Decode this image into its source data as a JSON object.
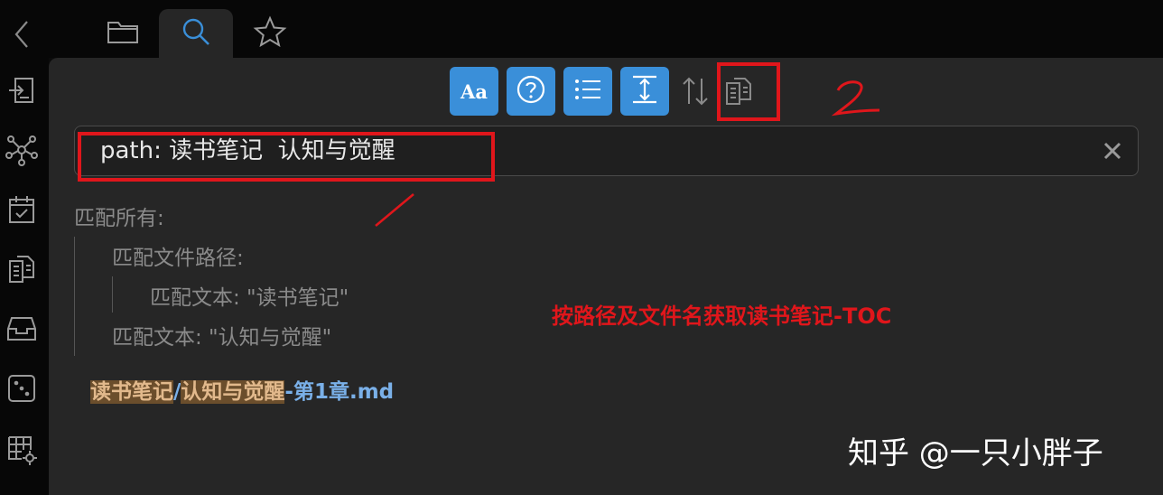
{
  "tabs": [
    {
      "name": "files",
      "icon": "folder-icon"
    },
    {
      "name": "search",
      "icon": "search-icon",
      "active": true
    },
    {
      "name": "bookmarks",
      "icon": "star-icon"
    }
  ],
  "ribbon_icons": [
    "file-import-icon",
    "graph-view-icon",
    "daily-note-icon",
    "copy-icon",
    "archive-icon",
    "dice-icon",
    "table-settings-icon"
  ],
  "toolbar": {
    "match_case_label": "Aa",
    "buttons": [
      "match-case",
      "explain-search",
      "collapse-results",
      "show-more-context",
      "sort",
      "copy-results"
    ],
    "active_color": "#3a8fd9"
  },
  "search": {
    "query": "path: 读书笔记  认知与觉醒"
  },
  "explain": {
    "root": "匹配所有:",
    "path_group": "匹配文件路径:",
    "path_text": "匹配文本: \"读书笔记\"",
    "text_match": "匹配文本: \"认知与觉醒\""
  },
  "result": {
    "folder": "读书笔记",
    "sep": "/",
    "name_hl": "认知与觉醒",
    "suffix": "-第1章.md"
  },
  "annotations": {
    "mark1": "/",
    "mark2": "2",
    "note": "按路径及文件名获取读书笔记-TOC",
    "color": "#e0161b"
  },
  "watermark": "知乎 @一只小胖子"
}
